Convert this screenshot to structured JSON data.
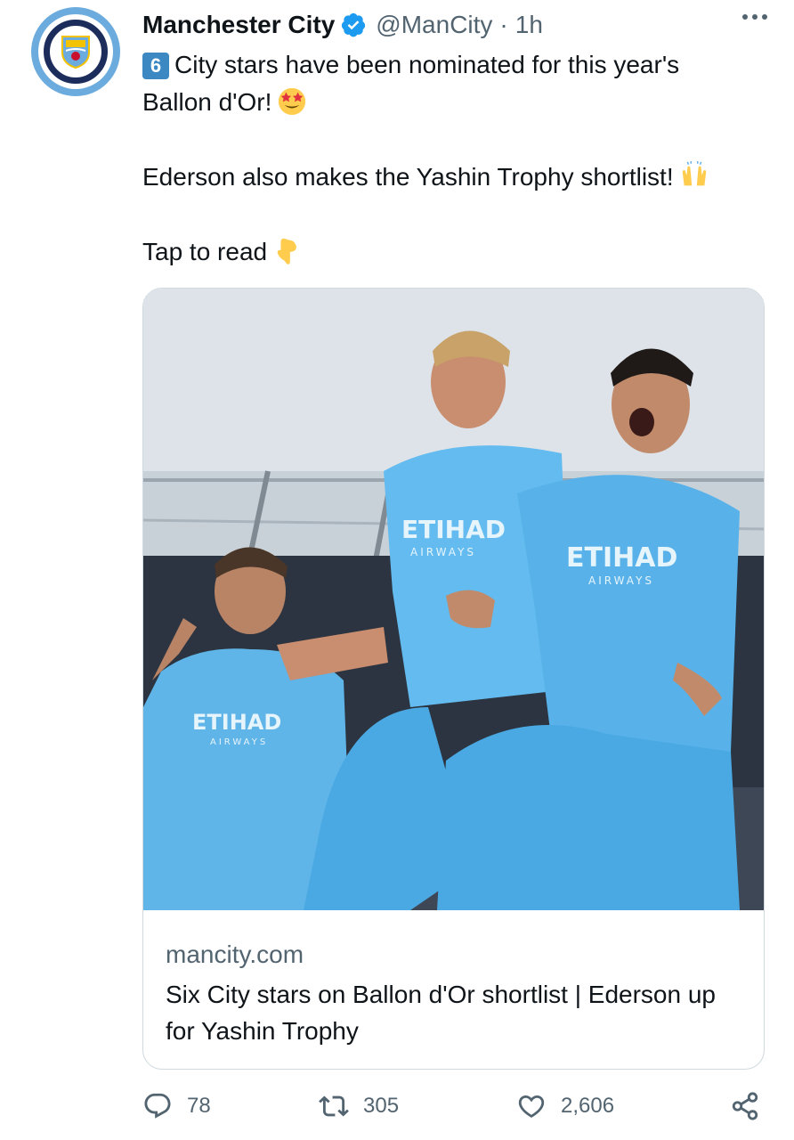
{
  "account": {
    "name": "Manchester City",
    "handle": "@ManCity",
    "separator": "·",
    "time": "1h",
    "avatar_text": "MANCHESTER CITY",
    "avatar_ring_top": "MANCHESTER",
    "avatar_ring_bottom": "CITY"
  },
  "tweet": {
    "keycap": "6",
    "line1": "City stars have been nominated for this year's",
    "line2": "Ballon d'Or!",
    "line3": "Ederson also makes the Yashin Trophy shortlist!",
    "line4": "Tap to read"
  },
  "card": {
    "image_text": {
      "sponsor_big": "ETIHAD",
      "sponsor_small": "AIRWAYS"
    },
    "domain": "mancity.com",
    "title": "Six City stars on Ballon d'Or shortlist | Ederson up for Yashin Trophy"
  },
  "actions": {
    "replies": "78",
    "retweets": "305",
    "likes": "2,606"
  },
  "colors": {
    "city_blue": "#6cabdd",
    "navy": "#1c2c5b",
    "verified_blue": "#1d9bf0",
    "muted": "#536471",
    "border": "#cfd9de"
  },
  "icons": {
    "verified": "verified-badge-icon",
    "more": "more-dots-icon",
    "reply": "reply-icon",
    "retweet": "retweet-icon",
    "like": "heart-icon",
    "share": "share-icon"
  }
}
